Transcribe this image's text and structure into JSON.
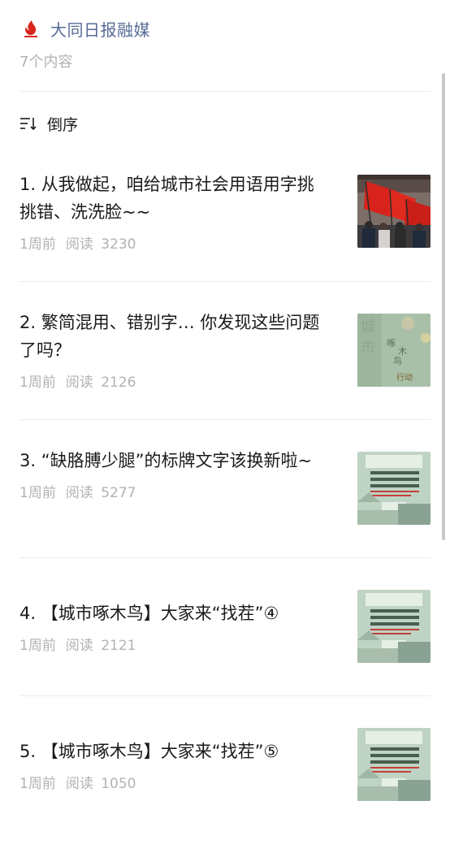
{
  "header": {
    "account_name": "大同日报融媒",
    "logo_icon": "red-flame-logo",
    "content_count": "7个内容"
  },
  "sort": {
    "icon": "sort-list-icon",
    "label": "倒序"
  },
  "articles": [
    {
      "index_title": "1. 从我做起，咱给城市社会用语用字挑挑错、洗洗脸~~",
      "time": "1周前",
      "reads_label": "阅读",
      "reads": "3230",
      "thumb": "red-flags-crowd-photo"
    },
    {
      "index_title": "2. 繁简混用、错别字… 你发现这些问题了吗？",
      "time": "1周前",
      "reads_label": "阅读",
      "reads": "2126",
      "thumb": "city-woodpecker-poster"
    },
    {
      "index_title": "3. “缺胳膊少腿”的标牌文字该换新啦~",
      "time": "1周前",
      "reads_label": "阅读",
      "reads": "5277",
      "thumb": "green-civilization-poster"
    },
    {
      "index_title": "4. 【城市啄木鸟】大家来“找茬”④",
      "time": "1周前",
      "reads_label": "阅读",
      "reads": "2121",
      "thumb": "green-civilization-poster"
    },
    {
      "index_title": "5. 【城市啄木鸟】大家来“找茬”⑤",
      "time": "1周前",
      "reads_label": "阅读",
      "reads": "1050",
      "thumb": "green-civilization-poster"
    }
  ],
  "colors": {
    "account_link": "#576b95",
    "meta_gray": "#b2b2b2",
    "divider": "#ececec"
  }
}
